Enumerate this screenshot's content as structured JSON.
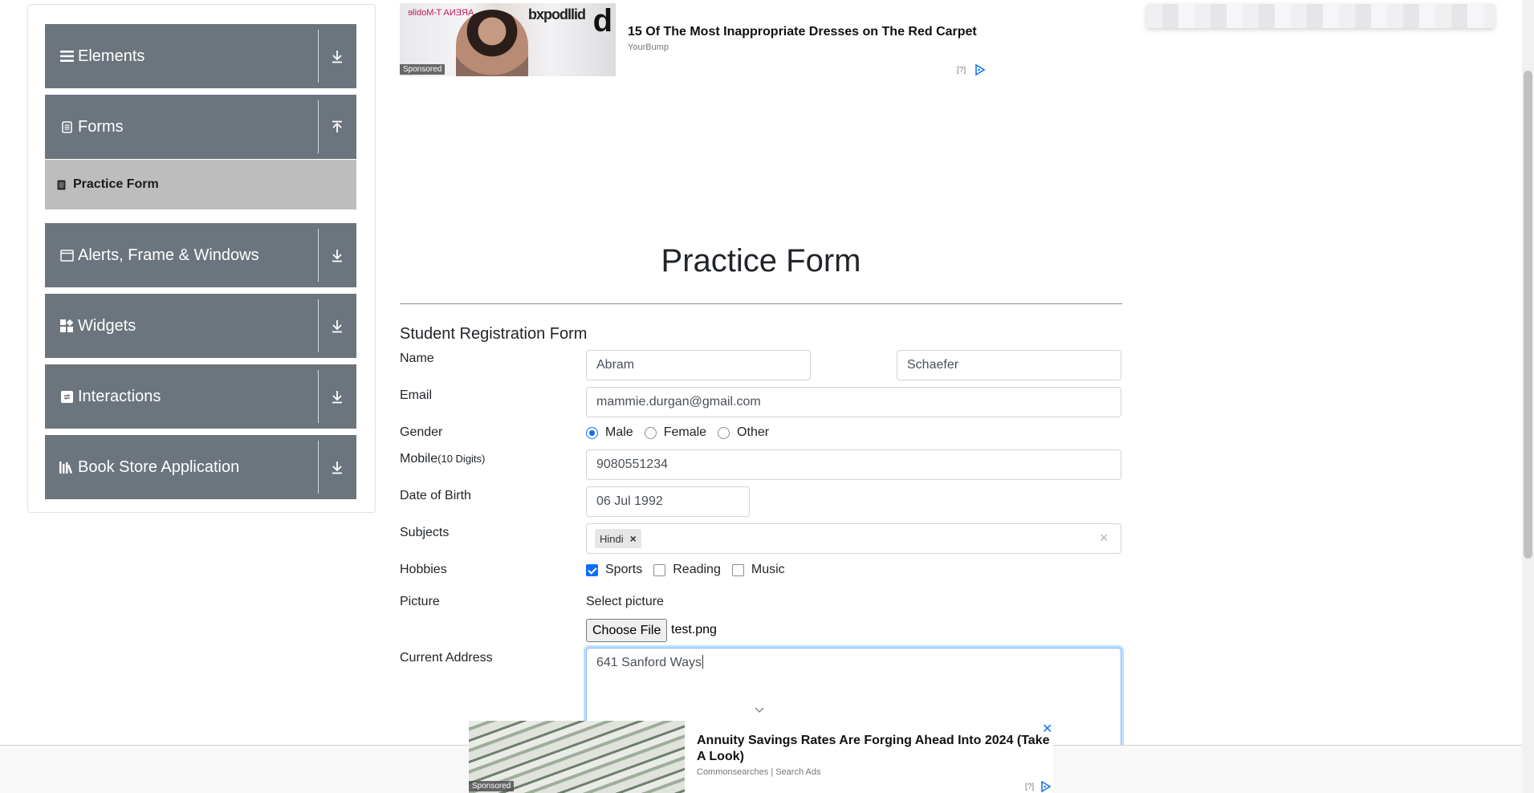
{
  "sidebar": {
    "groups": [
      {
        "label": "Elements",
        "icon": "hamburger-icon",
        "arrow": "download-arrow-icon"
      },
      {
        "label": "Forms",
        "icon": "document-icon",
        "arrow": "upload-arrow-icon"
      },
      {
        "label": "Alerts, Frame & Windows",
        "icon": "window-icon",
        "arrow": "download-arrow-icon"
      },
      {
        "label": "Widgets",
        "icon": "widgets-icon",
        "arrow": "download-arrow-icon"
      },
      {
        "label": "Interactions",
        "icon": "interactions-icon",
        "arrow": "download-arrow-icon"
      },
      {
        "label": "Book Store Application",
        "icon": "books-icon",
        "arrow": "download-arrow-icon"
      }
    ],
    "active_item": {
      "label": "Practice Form",
      "icon": "form-icon"
    }
  },
  "ad_top": {
    "title": "15 Of The Most Inappropriate Dresses on The Red Carpet",
    "source": "YourBump",
    "sponsored": "Sponsored",
    "help": "[?]",
    "image_brand_text": "bxpodllid",
    "image_tmobile_text": "ARENA T-Mobile",
    "image_d_text": "d"
  },
  "page": {
    "title": "Practice Form"
  },
  "form": {
    "heading": "Student Registration Form",
    "name_label": "Name",
    "first_name": "Abram",
    "last_name": "Schaefer",
    "email_label": "Email",
    "email": "mammie.durgan@gmail.com",
    "gender_label": "Gender",
    "genders": [
      {
        "label": "Male",
        "checked": true
      },
      {
        "label": "Female",
        "checked": false
      },
      {
        "label": "Other",
        "checked": false
      }
    ],
    "mobile_label": "Mobile",
    "mobile_hint": "(10 Digits)",
    "mobile": "9080551234",
    "dob_label": "Date of Birth",
    "dob": "06 Jul 1992",
    "subjects_label": "Subjects",
    "subjects": [
      "Hindi"
    ],
    "subject_remove": "×",
    "subjects_clear": "×",
    "hobbies_label": "Hobbies",
    "hobbies": [
      {
        "label": "Sports",
        "checked": true
      },
      {
        "label": "Reading",
        "checked": false
      },
      {
        "label": "Music",
        "checked": false
      }
    ],
    "picture_label": "Picture",
    "picture_prompt": "Select picture",
    "choose_file": "Choose File",
    "file_name": "test.png",
    "address_label": "Current Address",
    "address": "641 Sanford Ways"
  },
  "ad_bottom": {
    "title": "Annuity Savings Rates Are Forging Ahead Into 2024 (Take A Look)",
    "source": "Commonsearches | Search Ads",
    "sponsored": "Sponsored",
    "help": "[?]",
    "close": "✕"
  },
  "colors": {
    "sidebar_group": "#6c757d",
    "active_item": "#bdbdbd",
    "accent": "#0d6efd"
  }
}
